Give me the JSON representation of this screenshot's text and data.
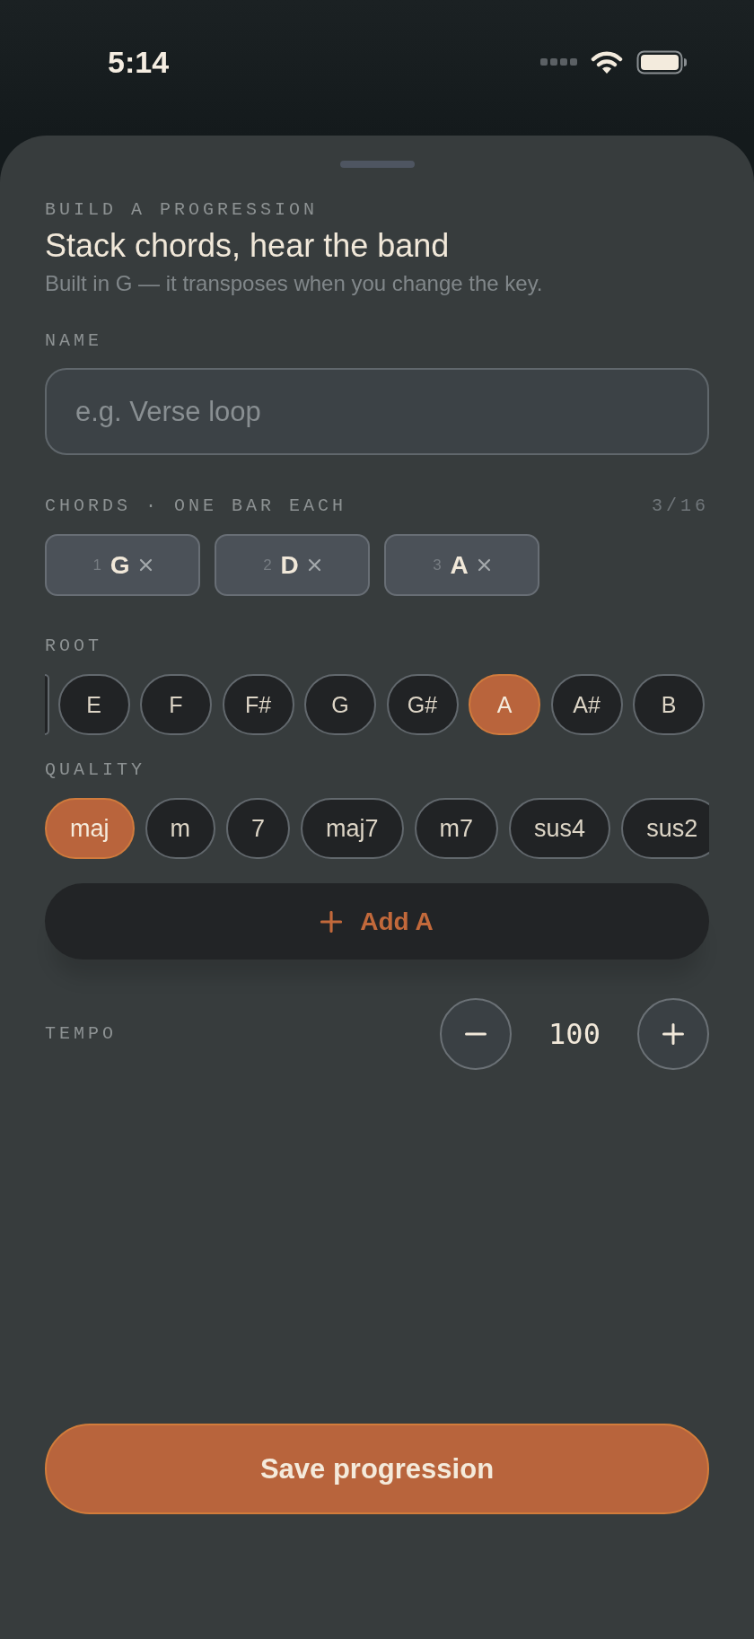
{
  "status_bar": {
    "time": "5:14"
  },
  "sheet": {
    "eyebrow": "BUILD A PROGRESSION",
    "title": "Stack chords, hear the band",
    "subtitle": "Built in G — it transposes when you change the key.",
    "name_field": {
      "label": "NAME",
      "placeholder": "e.g. Verse loop"
    },
    "chords": {
      "label": "CHORDS · ONE BAR EACH",
      "count": "3/16",
      "items": [
        {
          "number": "1",
          "chord": "G"
        },
        {
          "number": "2",
          "chord": "D"
        },
        {
          "number": "3",
          "chord": "A"
        }
      ]
    },
    "root": {
      "label": "ROOT",
      "options": [
        {
          "label": "E",
          "selected": false
        },
        {
          "label": "F",
          "selected": false
        },
        {
          "label": "F#",
          "selected": false
        },
        {
          "label": "G",
          "selected": false
        },
        {
          "label": "G#",
          "selected": false
        },
        {
          "label": "A",
          "selected": true
        },
        {
          "label": "A#",
          "selected": false
        },
        {
          "label": "B",
          "selected": false
        }
      ]
    },
    "quality": {
      "label": "QUALITY",
      "options": [
        {
          "label": "maj",
          "selected": true
        },
        {
          "label": "m",
          "selected": false
        },
        {
          "label": "7",
          "selected": false
        },
        {
          "label": "maj7",
          "selected": false
        },
        {
          "label": "m7",
          "selected": false
        },
        {
          "label": "sus4",
          "selected": false
        },
        {
          "label": "sus2",
          "selected": false
        }
      ]
    },
    "add_button": {
      "label": "Add A"
    },
    "tempo": {
      "label": "TEMPO",
      "value": "100"
    },
    "save_button": {
      "label": "Save progression"
    }
  }
}
